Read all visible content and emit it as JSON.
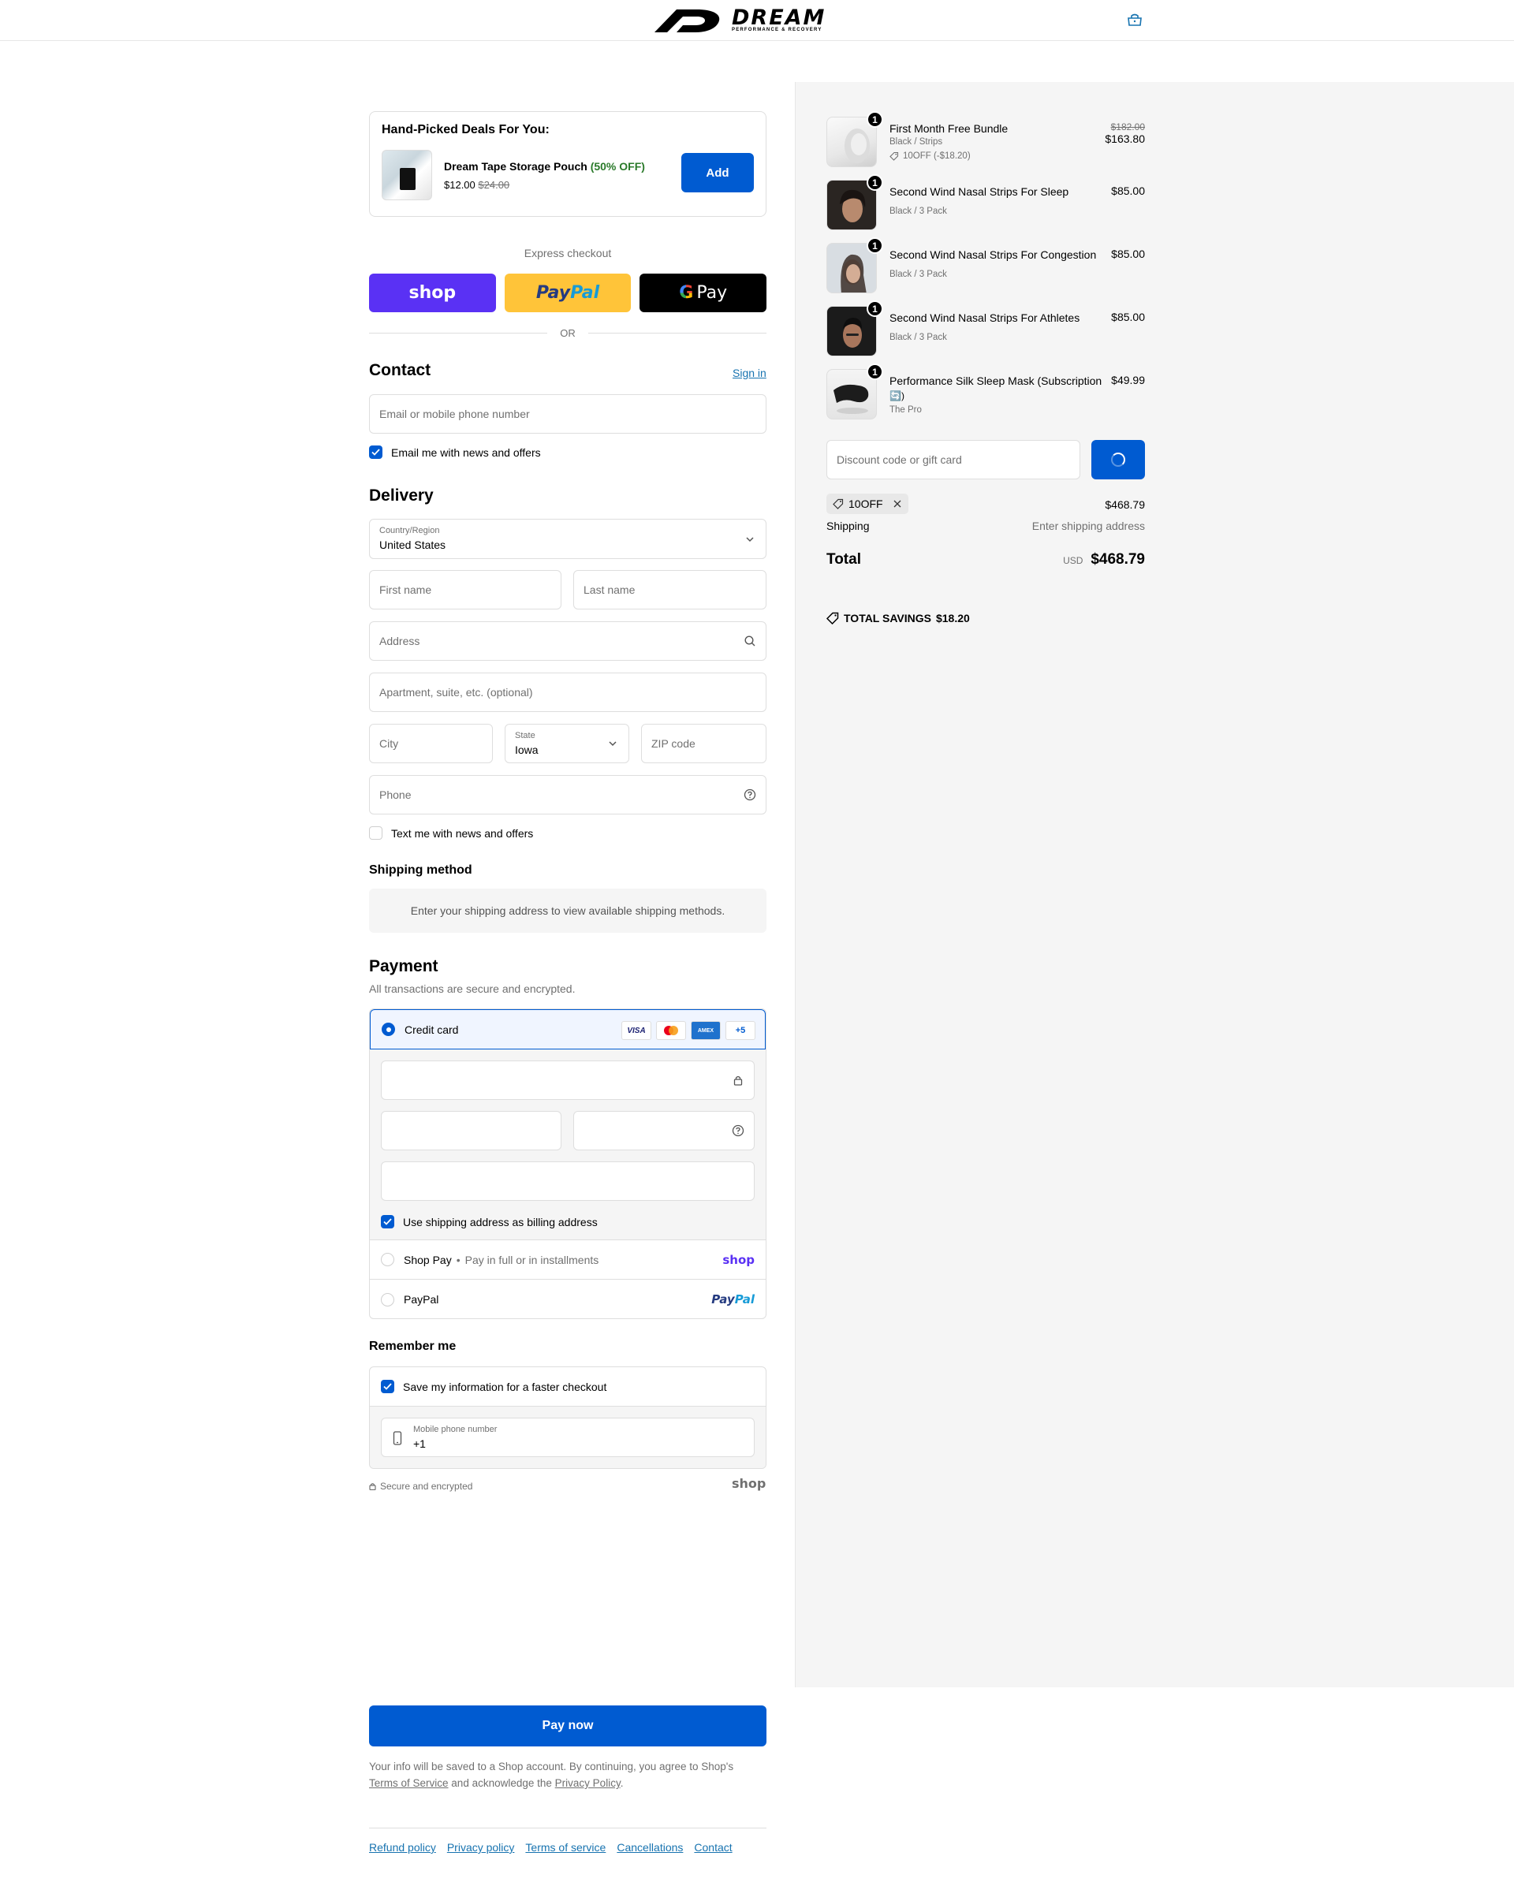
{
  "brand": {
    "name": "DREAM",
    "tagline": "PERFORMANCE & RECOVERY"
  },
  "deals": {
    "title": "Hand-Picked Deals For You:",
    "product_name": "Dream Tape Storage Pouch",
    "discount": "(50% OFF)",
    "price": "$12.00",
    "compare_price": "$24.00",
    "add_label": "Add"
  },
  "express": {
    "label": "Express checkout",
    "shop": "shop",
    "paypal_1": "Pay",
    "paypal_2": "Pal",
    "gpay_g": "G",
    "gpay_text": "Pay",
    "or": "OR"
  },
  "contact": {
    "title": "Contact",
    "sign_in": "Sign in",
    "email_placeholder": "Email or mobile phone number",
    "news_label": "Email me with news and offers"
  },
  "delivery": {
    "title": "Delivery",
    "country_label": "Country/Region",
    "country_value": "United States",
    "first_name": "First name",
    "last_name": "Last name",
    "address": "Address",
    "apartment": "Apartment, suite, etc. (optional)",
    "city": "City",
    "state_label": "State",
    "state_value": "Iowa",
    "zip": "ZIP code",
    "phone": "Phone",
    "text_label": "Text me with news and offers"
  },
  "shipping_method": {
    "title": "Shipping method",
    "notice": "Enter your shipping address to view available shipping methods."
  },
  "payment": {
    "title": "Payment",
    "subtitle": "All transactions are secure and encrypted.",
    "credit_card": "Credit card",
    "card_brands": [
      "VISA",
      "MC",
      "AMEX",
      "+5"
    ],
    "billing_label": "Use shipping address as billing address",
    "shop_pay": "Shop Pay",
    "shop_pay_sub": "Pay in full or in installments",
    "shop_brand": "shop",
    "paypal": "PayPal",
    "paypal_brand_1": "Pay",
    "paypal_brand_2": "Pal"
  },
  "remember": {
    "title": "Remember me",
    "save_label": "Save my information for a faster checkout",
    "mobile_label": "Mobile phone number",
    "mobile_value": "+1",
    "secure": "Secure and encrypted",
    "shop_brand": "shop"
  },
  "pay_now": "Pay now",
  "legal": {
    "text_1": "Your info will be saved to a Shop account. By continuing, you agree to Shop's",
    "tos": "Terms of Service",
    "text_2": "and acknowledge the",
    "privacy": "Privacy Policy",
    "period": "."
  },
  "footer_links": [
    "Refund policy",
    "Privacy policy",
    "Terms of service",
    "Cancellations",
    "Contact"
  ],
  "items": [
    {
      "qty": "1",
      "name": "First Month Free Bundle",
      "variant": "Black / Strips",
      "discount": "10OFF (-$18.20)",
      "compare": "$182.00",
      "price": "$163.80"
    },
    {
      "qty": "1",
      "name": "Second Wind Nasal Strips For Sleep",
      "variant": "Black / 3 Pack",
      "price": "$85.00"
    },
    {
      "qty": "1",
      "name": "Second Wind Nasal Strips For Congestion",
      "variant": "Black / 3 Pack",
      "price": "$85.00"
    },
    {
      "qty": "1",
      "name": "Second Wind Nasal Strips For Athletes",
      "variant": "Black / 3 Pack",
      "price": "$85.00"
    },
    {
      "qty": "1",
      "name": "Performance Silk Sleep Mask (Subscription",
      "name_2": "🔄)",
      "variant": "The Pro",
      "price": "$49.99"
    }
  ],
  "summary": {
    "discount_placeholder": "Discount code or gift card",
    "code": "10OFF",
    "subtotal": "$468.79",
    "shipping_label": "Shipping",
    "shipping_value": "Enter shipping address",
    "total_label": "Total",
    "currency": "USD",
    "total": "$468.79",
    "savings_label": "TOTAL SAVINGS",
    "savings_value": "$18.20"
  },
  "colors": {
    "accent": "#005bd1",
    "shop": "#5a31f4",
    "paypal": "#ffc439"
  }
}
